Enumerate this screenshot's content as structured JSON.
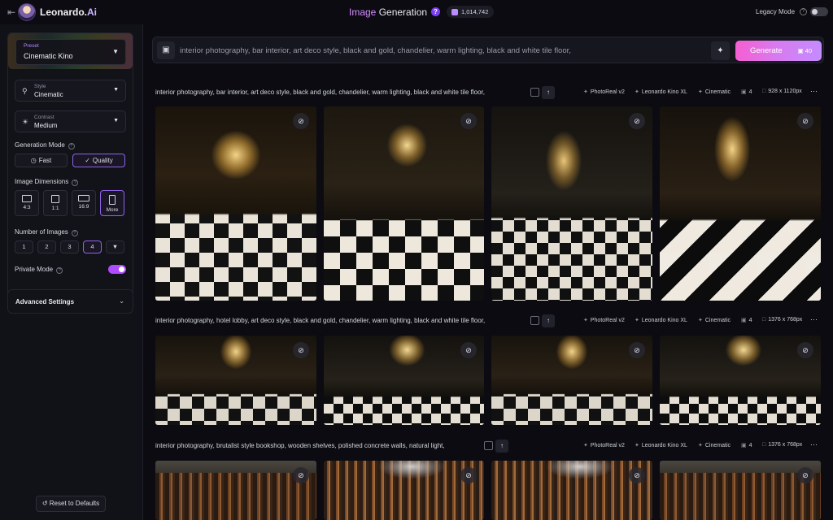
{
  "header": {
    "brand_main": "Leonardo.",
    "brand_suffix": "Ai",
    "title_highlight": "Image",
    "title_rest": " Generation",
    "tokens": "1,014,742",
    "legacy_mode_label": "Legacy Mode",
    "legacy_mode_on": false
  },
  "sidebar": {
    "preset": {
      "label": "Preset",
      "value": "Cinematic Kino"
    },
    "style": {
      "label": "Style",
      "value": "Cinematic"
    },
    "contrast": {
      "label": "Contrast",
      "value": "Medium"
    },
    "generation_mode": {
      "label": "Generation Mode",
      "options": [
        "Fast",
        "Quality"
      ],
      "selected": "Quality"
    },
    "image_dimensions": {
      "label": "Image Dimensions",
      "options": [
        "4:3",
        "1:1",
        "16:9",
        "More"
      ],
      "selected": "More"
    },
    "number_of_images": {
      "label": "Number of Images",
      "options": [
        "1",
        "2",
        "3",
        "4"
      ],
      "selected": "4"
    },
    "private_mode": {
      "label": "Private Mode",
      "on": true
    },
    "advanced_settings": "Advanced Settings",
    "reset": "Reset to Defaults"
  },
  "prompt_bar": {
    "text": "interior photography, bar interior, art deco style, black and gold, chandelier, warm lighting, black and white tile floor,",
    "generate_label": "Generate",
    "generate_cost": "40"
  },
  "generations": [
    {
      "prompt": "interior photography, bar interior, art deco style, black and gold, chandelier, warm lighting, black and white tile floor,",
      "model": "PhotoReal v2",
      "base": "Leonardo Kino XL",
      "style": "Cinematic",
      "count": "4",
      "size": "928 x 1120px"
    },
    {
      "prompt": "interior photography, hotel lobby, art deco style, black and gold, chandelier, warm lighting, black and white tile floor,",
      "model": "PhotoReal v2",
      "base": "Leonardo Kino XL",
      "style": "Cinematic",
      "count": "4",
      "size": "1376 x 768px"
    },
    {
      "prompt": "interior photography, brutalist style bookshop, wooden shelves, polished concrete walls, natural light,",
      "model": "PhotoReal v2",
      "base": "Leonardo Kino XL",
      "style": "Cinematic",
      "count": "4",
      "size": "1376 x 768px"
    }
  ],
  "colors": {
    "accent": "#b14bff",
    "generate_gradient_start": "#f45fd2",
    "generate_gradient_end": "#c48cff",
    "background": "#0b0b11"
  },
  "icons": {
    "back": "arrow-left-icon",
    "help": "question-icon",
    "token": "coin-icon",
    "image_prompt": "image-icon",
    "magic": "sparkle-icon",
    "hide": "eye-off-icon",
    "copy": "copy-icon",
    "upscale": "arrow-up-icon",
    "more": "ellipsis-icon"
  }
}
